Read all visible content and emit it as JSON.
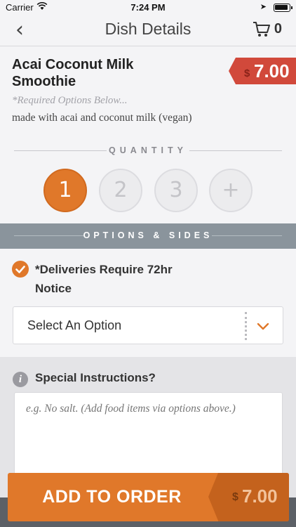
{
  "status_bar": {
    "carrier": "Carrier",
    "time": "7:24 PM"
  },
  "nav": {
    "title": "Dish Details",
    "cart_count": "0"
  },
  "dish": {
    "name": "Acai Coconut Milk Smoothie",
    "price_currency": "$",
    "price": "7.00",
    "required_note": "*Required Options Below...",
    "description": "made with acai and coconut milk (vegan)"
  },
  "quantity": {
    "label": "QUANTITY",
    "options": [
      "1",
      "2",
      "3",
      "+"
    ],
    "selected": "1"
  },
  "options": {
    "header": "OPTIONS & SIDES",
    "item_title": "*Deliveries Require 72hr Notice",
    "select_value": "Select An Option"
  },
  "special": {
    "title": "Special Instructions?",
    "placeholder": "e.g. No salt. (Add food items via options above.)"
  },
  "footer": {
    "add_label": "ADD TO ORDER",
    "price_currency": "$",
    "price": "7.00"
  },
  "colors": {
    "accent": "#e0782a",
    "price_tag": "#d1493b",
    "header_bar": "#8a949c"
  }
}
